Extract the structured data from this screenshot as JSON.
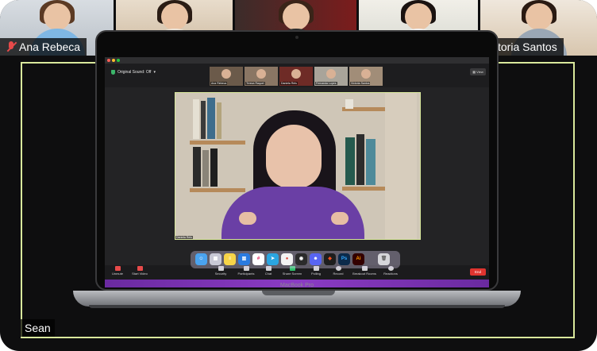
{
  "outer_participants": [
    {
      "name": "Ana Rebeca",
      "muted": true
    },
    {
      "name": "",
      "muted": false
    },
    {
      "name": "",
      "muted": false
    },
    {
      "name": "",
      "muted": false
    },
    {
      "name": "Victoria Santos",
      "muted": false
    }
  ],
  "outer_name_tags": {
    "left": "Ana Rebeca",
    "right": "ctoria Santos"
  },
  "self_view": {
    "name": "Sean"
  },
  "laptop": {
    "model_label": "MacBook Pro"
  },
  "inner_meeting": {
    "sound_label": "Original Sound: Off",
    "view_label": "View",
    "participants": [
      "Ana Rebeca",
      "Tereza Raquel",
      "Daniela Reis",
      "Fernanda Lopes",
      "Victoria Santos"
    ],
    "main_speaker_name": "Daniela Reis",
    "toolbar": {
      "unmute": "Unmute",
      "start_video": "Start Video",
      "security": "Security",
      "participants": "Participants",
      "participants_count": "1",
      "chat": "Chat",
      "share_screen": "Share Screen",
      "polling": "Polling",
      "record": "Record",
      "breakout_rooms": "Breakout Rooms",
      "reactions": "Reactions",
      "end": "End"
    }
  },
  "dock_icons": [
    "finder-icon",
    "launchpad-icon",
    "notes-icon",
    "trello-icon",
    "slack-icon",
    "telegram-icon",
    "chrome-icon",
    "obs-icon",
    "discord-icon",
    "figma-icon",
    "photoshop-icon",
    "illustrator-icon",
    "trash-icon"
  ],
  "colors": {
    "speaker_border": "#d9e89c",
    "end_button": "#e0342f",
    "dock_gradient": "#8b3bc4",
    "muted_icon": "#e74a4a"
  }
}
